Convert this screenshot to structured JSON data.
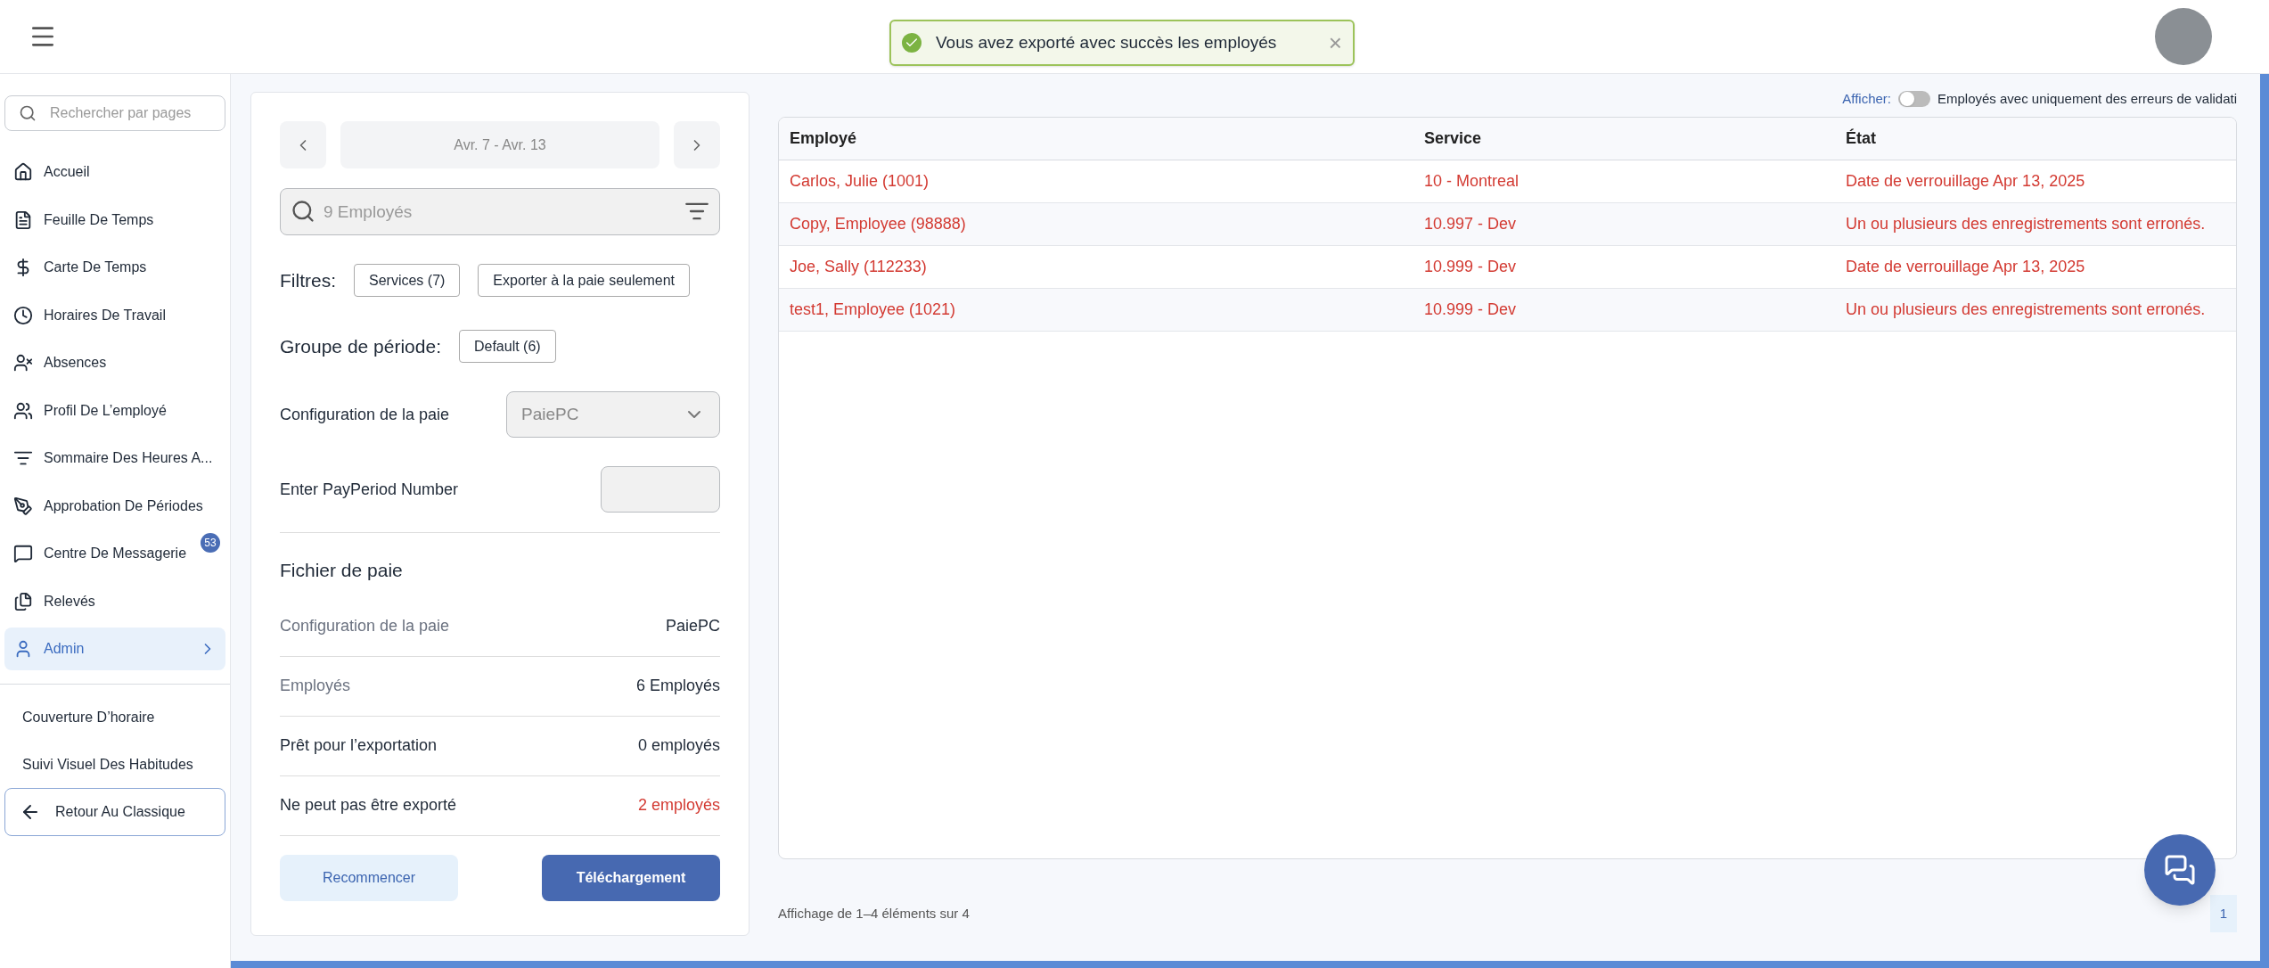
{
  "toast": {
    "message": "Vous avez exporté avec succès les employés",
    "close": "×"
  },
  "sidebar": {
    "search_placeholder": "Rechercher par pages",
    "items": [
      {
        "label": "Accueil",
        "selected": false
      },
      {
        "label": "Feuille De Temps",
        "selected": false
      },
      {
        "label": "Carte De Temps",
        "selected": false
      },
      {
        "label": "Horaires De Travail",
        "selected": false
      },
      {
        "label": "Absences",
        "selected": false
      },
      {
        "label": "Profil De L’employé",
        "selected": false
      },
      {
        "label": "Sommaire Des Heures A...",
        "selected": false
      },
      {
        "label": "Approbation De Périodes",
        "selected": false
      },
      {
        "label": "Centre De Messagerie",
        "selected": false,
        "badge": "53"
      },
      {
        "label": "Relevés",
        "selected": false
      },
      {
        "label": "Admin",
        "selected": true
      }
    ],
    "extra_links": [
      "Couverture D’horaire",
      "Suivi Visuel Des Habitudes"
    ],
    "back_button": "Retour Au Classique"
  },
  "panel": {
    "date_range": "Avr. 7 - Avr. 13",
    "search_placeholder": "9 Employés",
    "filters_label": "Filtres:",
    "filters": [
      "Services (7)",
      "Exporter à la paie seulement"
    ],
    "group_label": "Groupe de période:",
    "group_value": "Default (6)",
    "config_label": "Configuration de la paie",
    "config_value": "PaiePC",
    "payperiod_label": "Enter PayPeriod Number",
    "file_title": "Fichier de paie",
    "summary": [
      {
        "label": "Configuration de la paie",
        "value": "PaiePC",
        "muted": true,
        "error": false
      },
      {
        "label": "Employés",
        "value": "6 Employés",
        "muted": true,
        "error": false
      },
      {
        "label": "Prêt pour l’exportation",
        "value": "0 employés",
        "muted": false,
        "error": false
      },
      {
        "label": "Ne peut pas être exporté",
        "value": "2 employés",
        "muted": false,
        "error": true
      }
    ],
    "restart_button": "Recommencer",
    "download_button": "Téléchargement"
  },
  "table": {
    "toggle_label": "Afficher:",
    "toggle_text": "Employés avec uniquement des erreurs de validati",
    "toggle_on": false,
    "columns": [
      "Employé",
      "Service",
      "État"
    ],
    "rows": [
      [
        "Carlos, Julie (1001)",
        "10 - Montreal",
        "Date de verrouillage Apr 13, 2025"
      ],
      [
        "Copy, Employee (98888)",
        "10.997 - Dev",
        "Un ou plusieurs des enregistrements sont erronés."
      ],
      [
        "Joe, Sally (112233)",
        "10.999 - Dev",
        "Date de verrouillage Apr 13, 2025"
      ],
      [
        "test1, Employee (1021)",
        "10.999 - Dev",
        "Un ou plusieurs des enregistrements sont erronés."
      ]
    ],
    "footer": "Affichage de 1–4 éléments sur 4",
    "page": "1"
  }
}
